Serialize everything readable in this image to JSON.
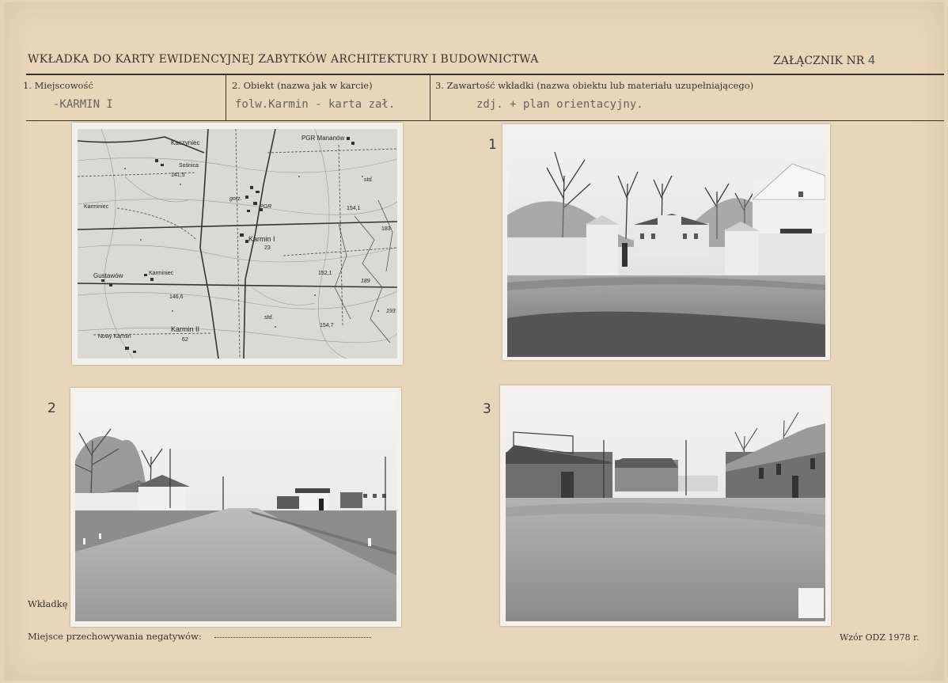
{
  "header": {
    "title": "WKŁADKA DO KARTY EWIDENCYJNEJ ZABYTKÓW  ARCHITEKTURY I BUDOWNICTWA",
    "annex_label": "ZAŁĄCZNIK NR",
    "annex_number": "4"
  },
  "fields": [
    {
      "label": "1.  Miejscowość",
      "value": "-KARMIN  I"
    },
    {
      "label": "2.  Obiekt (nazwa jak w karcie)",
      "value": "folw.Karmin - karta zał."
    },
    {
      "label": "3.  Zawartość wkładki (nazwa obiektu lub materiału uzupełniającego)",
      "value": "zdj. + plan orientacyjny."
    }
  ],
  "map": {
    "labels": {
      "kaczyniec": "Kaczyniec",
      "pgr_mananow": "PGR Mananów",
      "sosnica": "Sośnica",
      "elev_1415": "141,5",
      "karminiec_1": "Karminiec",
      "gorz": "gorz.",
      "pgr": "PGR",
      "std_1": "std.",
      "elev_1541": "154,1",
      "karmin_1": "Karmin I",
      "elev_23": "23",
      "elev_183": "183",
      "gustawow": "Gustawów",
      "karminiec_2": "Karminiec",
      "elev_1521": "152,1",
      "elev_189": "189",
      "elev_1466": "146,6",
      "elev_193": "193",
      "std_2": "std.",
      "karmin_2": "Karmin II",
      "elev_62": "62",
      "elev_1547": "154,7",
      "nowy_karmin": "Nowy Karmin"
    }
  },
  "photo_numbers": {
    "p1": "1",
    "p2": "2",
    "p3": "3"
  },
  "footer": {
    "wkladke": "Wkładkę",
    "negatives": "Miejsce przechowywania negatywów:",
    "form": "Wzór ODZ 1978 r."
  },
  "colors": {
    "card": "#e8d6bb",
    "ink": "#3a332c",
    "typewriter": "#6a615a"
  }
}
